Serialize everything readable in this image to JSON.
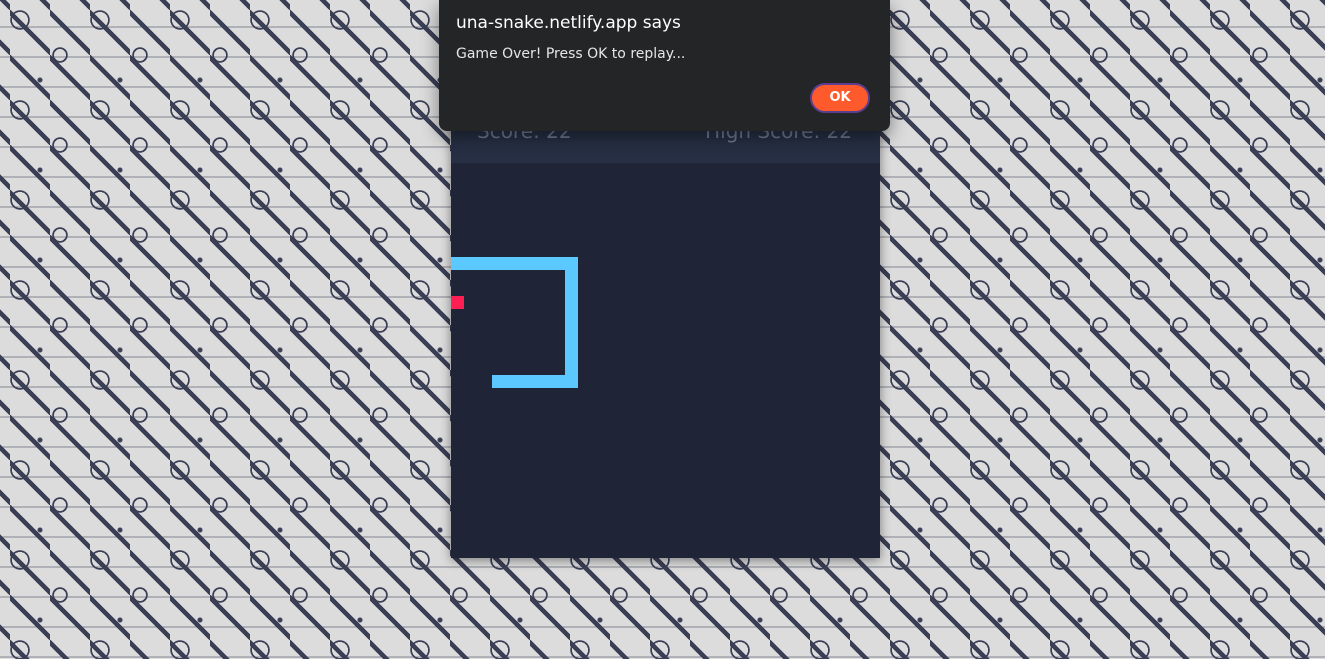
{
  "dialog": {
    "title": "una-snake.netlify.app says",
    "message": "Game Over! Press OK to replay...",
    "ok_label": "OK",
    "ok_color": "#ff5a2c"
  },
  "game": {
    "score_label": "Score: 22",
    "high_score_label": "High Score: 22",
    "board_color": "#1f2536",
    "snake_color": "#5bc8ff",
    "food_color": "#ff1f53"
  }
}
